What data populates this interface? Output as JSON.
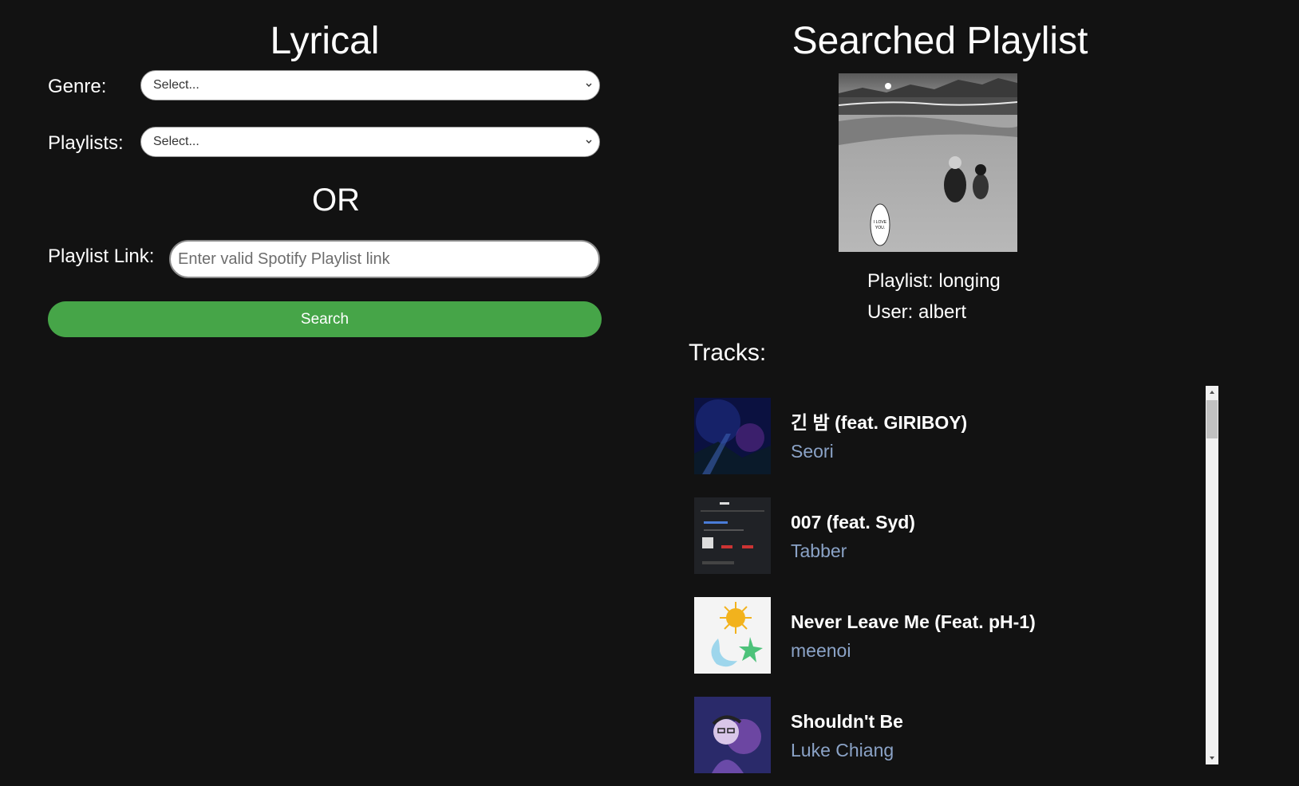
{
  "app": {
    "title": "Lyrical"
  },
  "form": {
    "genre_label": "Genre:",
    "genre_value": "Select...",
    "playlists_label": "Playlists:",
    "playlists_value": "Select...",
    "or_text": "OR",
    "link_label": "Playlist Link:",
    "link_placeholder": "Enter valid Spotify Playlist link",
    "search_label": "Search"
  },
  "playlist": {
    "heading": "Searched Playlist",
    "name_line": "Playlist: longing",
    "user_line": "User: albert",
    "tracks_label": "Tracks:",
    "tracks": [
      {
        "title": "긴 밤 (feat. GIRIBOY)",
        "artist": "Seori"
      },
      {
        "title": "007 (feat. Syd)",
        "artist": "Tabber"
      },
      {
        "title": "Never Leave Me (Feat. pH-1)",
        "artist": "meenoi"
      },
      {
        "title": "Shouldn't Be",
        "artist": "Luke Chiang"
      }
    ]
  },
  "colors": {
    "background": "#121212",
    "accent_button": "#46a548",
    "artist_text": "#8ba3c7"
  },
  "icons": {
    "select_chevron": "chevron-down-icon",
    "scroll_up": "triangle-up-icon",
    "scroll_down": "triangle-down-icon"
  }
}
